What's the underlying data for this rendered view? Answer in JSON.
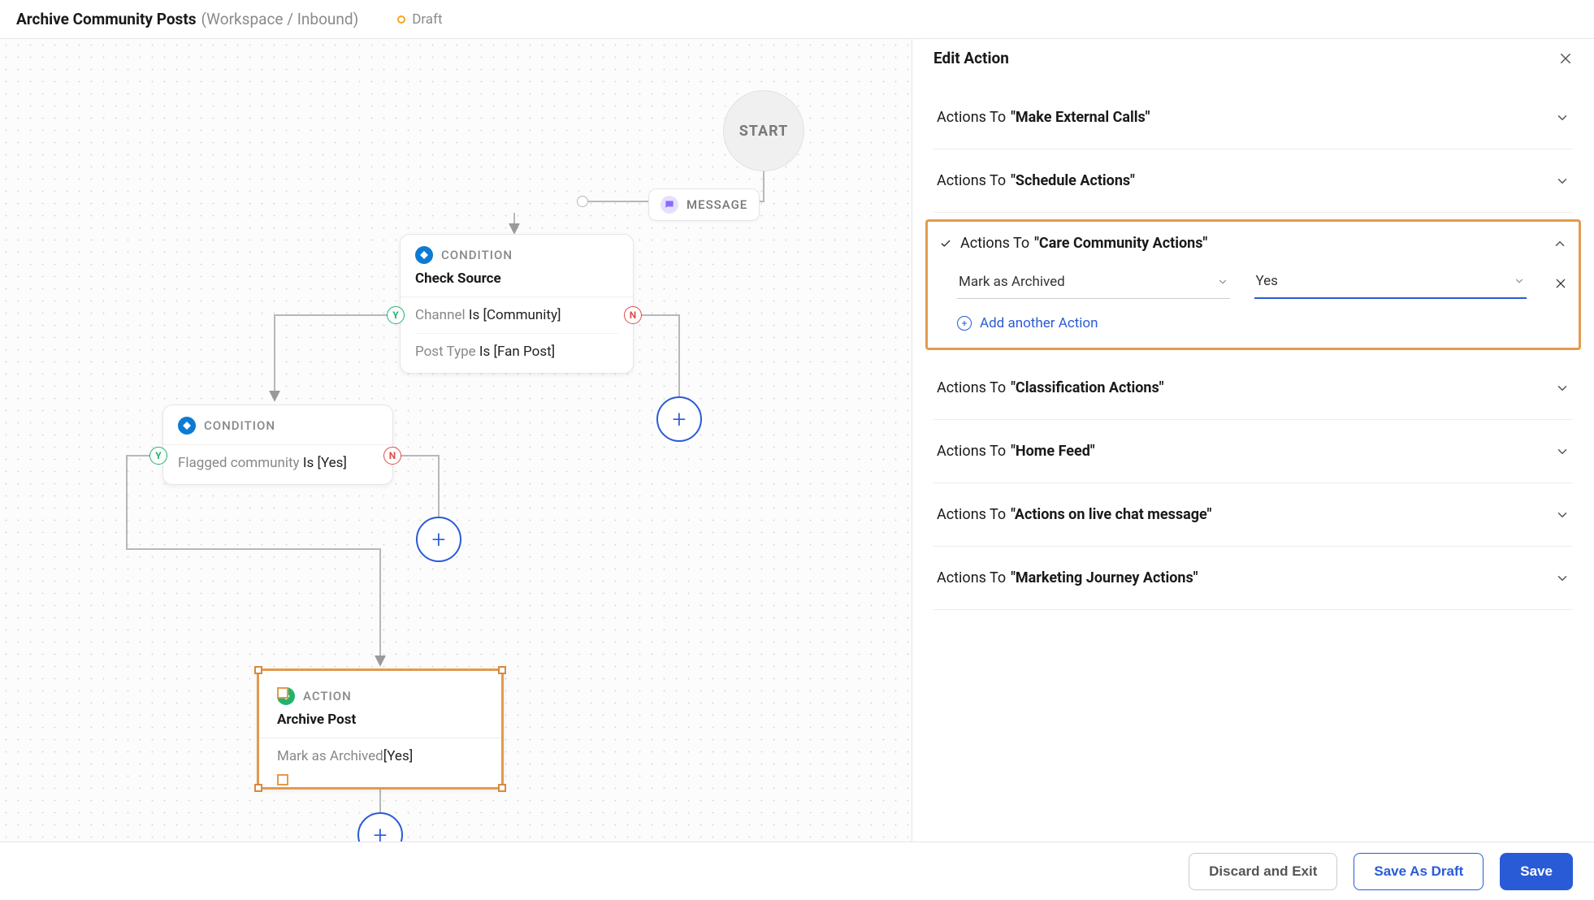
{
  "header": {
    "title": "Archive Community Posts",
    "breadcrumb": "(Workspace / Inbound)",
    "status": "Draft"
  },
  "nodes": {
    "start": {
      "label": "START"
    },
    "message": {
      "type": "MESSAGE"
    },
    "condition1": {
      "type": "CONDITION",
      "title": "Check Source",
      "rows": [
        {
          "k": "Channel",
          "op": "Is",
          "v": "[Community]"
        },
        {
          "k": "Post Type",
          "op": "Is",
          "v": "[Fan Post]"
        }
      ]
    },
    "condition2": {
      "type": "CONDITION",
      "rows": [
        {
          "k": "Flagged community",
          "op": "Is",
          "v": "[Yes]"
        }
      ]
    },
    "action1": {
      "type": "ACTION",
      "title": "Archive Post",
      "rows": [
        {
          "k": "Mark as Archived",
          "v": "[Yes]"
        }
      ]
    },
    "yn": {
      "y": "Y",
      "n": "N"
    }
  },
  "panel": {
    "title": "Edit Action",
    "sections": [
      {
        "id": "ext",
        "prefix": "Actions To ",
        "name": "\"Make External Calls\"",
        "expanded": false
      },
      {
        "id": "sched",
        "prefix": "Actions To ",
        "name": "\"Schedule Actions\"",
        "expanded": false
      },
      {
        "id": "care",
        "prefix": "Actions To ",
        "name": "\"Care Community Actions\"",
        "expanded": true,
        "selected": true,
        "fields": {
          "action_label": "Mark as Archived",
          "value_label": "Yes"
        },
        "add_label": "Add another Action"
      },
      {
        "id": "class",
        "prefix": "Actions To ",
        "name": "\"Classification Actions\"",
        "expanded": false
      },
      {
        "id": "home",
        "prefix": "Actions To ",
        "name": "\"Home Feed\"",
        "expanded": false
      },
      {
        "id": "live",
        "prefix": "Actions To ",
        "name": "\"Actions on live chat message\"",
        "expanded": false
      },
      {
        "id": "mkt",
        "prefix": "Actions To ",
        "name": "\"Marketing Journey Actions\"",
        "expanded": false
      }
    ]
  },
  "footer": {
    "discard": "Discard and Exit",
    "draft": "Save As Draft",
    "save": "Save"
  },
  "colors": {
    "accent_blue": "#2a5bd7",
    "highlight_orange": "#e39a4c",
    "green": "#1fb36b",
    "red": "#e24b4b",
    "purple": "#8a6bff"
  }
}
